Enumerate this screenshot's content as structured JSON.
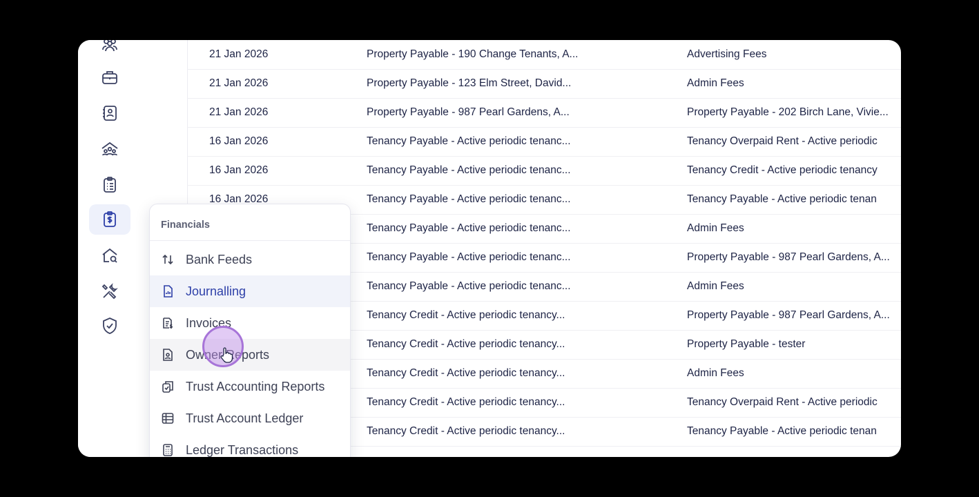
{
  "sidebar": {
    "icons": [
      "users-icon",
      "briefcase-icon",
      "contacts-icon",
      "tenants-icon",
      "clipboard-list-icon",
      "clipboard-dollar-icon",
      "home-search-icon",
      "tools-icon",
      "shield-check-icon"
    ],
    "active_index": 5
  },
  "table": {
    "rows": [
      {
        "date": "21 Jan 2026",
        "from": "Property Payable - 190 Change Tenants, A...",
        "to": "Advertising Fees"
      },
      {
        "date": "21 Jan 2026",
        "from": "Property Payable - 123 Elm Street, David...",
        "to": "Admin Fees"
      },
      {
        "date": "21 Jan 2026",
        "from": "Property Payable - 987 Pearl Gardens, A...",
        "to": "Property Payable - 202 Birch Lane, Vivie..."
      },
      {
        "date": "16 Jan 2026",
        "from": "Tenancy Payable - Active periodic tenanc...",
        "to": "Tenancy Overpaid Rent - Active periodic"
      },
      {
        "date": "16 Jan 2026",
        "from": "Tenancy Payable - Active periodic tenanc...",
        "to": "Tenancy Credit - Active periodic tenancy"
      },
      {
        "date": "16 Jan 2026",
        "from": "Tenancy Payable - Active periodic tenanc...",
        "to": "Tenancy Payable - Active periodic tenan"
      },
      {
        "date": "",
        "from": "Tenancy Payable - Active periodic tenanc...",
        "to": "Admin Fees"
      },
      {
        "date": "",
        "from": "Tenancy Payable - Active periodic tenanc...",
        "to": "Property Payable - 987 Pearl Gardens, A..."
      },
      {
        "date": "",
        "from": "Tenancy Payable - Active periodic tenanc...",
        "to": "Admin Fees"
      },
      {
        "date": "",
        "from": "Tenancy Credit - Active periodic tenancy...",
        "to": "Property Payable - 987 Pearl Gardens, A..."
      },
      {
        "date": "",
        "from": "Tenancy Credit - Active periodic tenancy...",
        "to": "Property Payable - tester"
      },
      {
        "date": "",
        "from": "Tenancy Credit - Active periodic tenancy...",
        "to": "Admin Fees"
      },
      {
        "date": "",
        "from": "Tenancy Credit - Active periodic tenancy...",
        "to": "Tenancy Overpaid Rent - Active periodic"
      },
      {
        "date": "",
        "from": "Tenancy Credit - Active periodic tenancy...",
        "to": "Tenancy Payable - Active periodic tenan"
      }
    ]
  },
  "menu": {
    "title": "Financials",
    "items": [
      {
        "label": "Bank Feeds",
        "icon": "arrows-up-down-icon"
      },
      {
        "label": "Journalling",
        "icon": "journal-icon"
      },
      {
        "label": "Invoices",
        "icon": "invoice-icon"
      },
      {
        "label": "Owner Reports",
        "icon": "owner-report-icon"
      },
      {
        "label": "Trust Accounting Reports",
        "icon": "copy-check-icon"
      },
      {
        "label": "Trust Account Ledger",
        "icon": "table-grid-icon"
      },
      {
        "label": "Ledger Transactions",
        "icon": "calculator-icon"
      }
    ],
    "active_item": "Journalling",
    "hover_item": "Owner Reports"
  },
  "colors": {
    "accent": "#2d3fa8",
    "text": "#1d2345",
    "cursor_ring": "#a774d8"
  }
}
